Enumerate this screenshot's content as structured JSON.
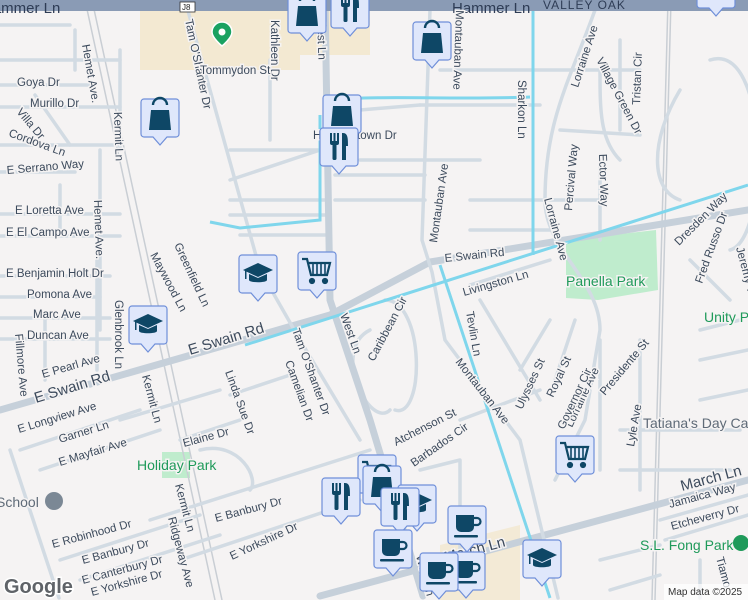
{
  "map": {
    "highway_shield": "J8",
    "attribution": "Map data ©2025",
    "logo": "Google",
    "colors": {
      "background": "#f5f3f3",
      "road": "#d2dbe3",
      "canal": "#7fd6ec",
      "park": "#bfeccd",
      "marker_fill": "#dfe7fb",
      "marker_icon": "#0e4766",
      "highway": "#8a9bb5"
    }
  },
  "places": {
    "tommydon": "Tommydon St",
    "school": "School",
    "holiday_park": "Holiday Park",
    "panella_park": "Panella Park",
    "unity_park": "Unity Park",
    "tatianas": "Tatiana's Day Care",
    "fong_park": "S.L. Fong Park"
  },
  "labels": [
    "Hammer Ln",
    "Hammer Ln",
    "VALLEY OAK",
    "Goya Dr",
    "Murillo Dr",
    "Villa Dr",
    "Cordova Ln",
    "E Serrano Way",
    "E Loretta Ave",
    "E El Campo Ave",
    "E Benjamin Holt Dr",
    "Pomona Ave",
    "Marc Ave",
    "Duncan Ave",
    "E Pearl Ave",
    "E Swain Rd",
    "E Swain Rd",
    "E Longview Ave",
    "Garner Ln",
    "E Mayfair Ave",
    "Elaine Dr",
    "E Robinhood Dr",
    "E Banbury Dr",
    "E Canterbury Dr",
    "E Yorkshire Dr",
    "E Banbury Dr",
    "E Yorkshire Dr",
    "Hemet Ave.",
    "Hemet Ave.",
    "Kermit Ln",
    "Kermit Ln",
    "Kermit Ln",
    "Ridgeway Ave",
    "Glenbrook Ln",
    "Fillmore Ave",
    "Linda Sue Dr",
    "Camelian Dr",
    "Tam O'Shanter Dr",
    "Tam O'Shanter Dr",
    "Maywood Ln",
    "Greenfield Ln",
    "Kathleen Dr",
    "West Ln",
    "West Ln",
    "Caribbean Cir",
    "Montauban Ave",
    "Montauban Ave",
    "Montauban Ave",
    "Sharkon Ln",
    "Lorraine Ave",
    "Lorraine Ave",
    "Lorraine Ave",
    "Village Green Dr",
    "Tristan Cir",
    "Percival Way",
    "Ector Way",
    "Dresden Way",
    "Fred Russo Dr",
    "Jeremy Way",
    "Livingston Ln",
    "E Swain Rd",
    "Tevlin Ln",
    "Ulysses St",
    "Royal St",
    "Governor Cir",
    "Presidente St",
    "Lyle Ave",
    "Atchenson St",
    "Barbados Cir",
    "March Ln",
    "Jamaica Way",
    "Etcheverry Dr",
    "Tiamo",
    "E March Ln",
    "Hammertown Dr",
    "West Ln"
  ],
  "markers": [
    "shopping",
    "restaurant",
    "shopping",
    "shopping",
    "shopping",
    "restaurant",
    "school",
    "grocery",
    "school",
    "grocery",
    "restaurant",
    "restaurant",
    "cafe",
    "cafe",
    "cafe",
    "cafe",
    "school"
  ]
}
